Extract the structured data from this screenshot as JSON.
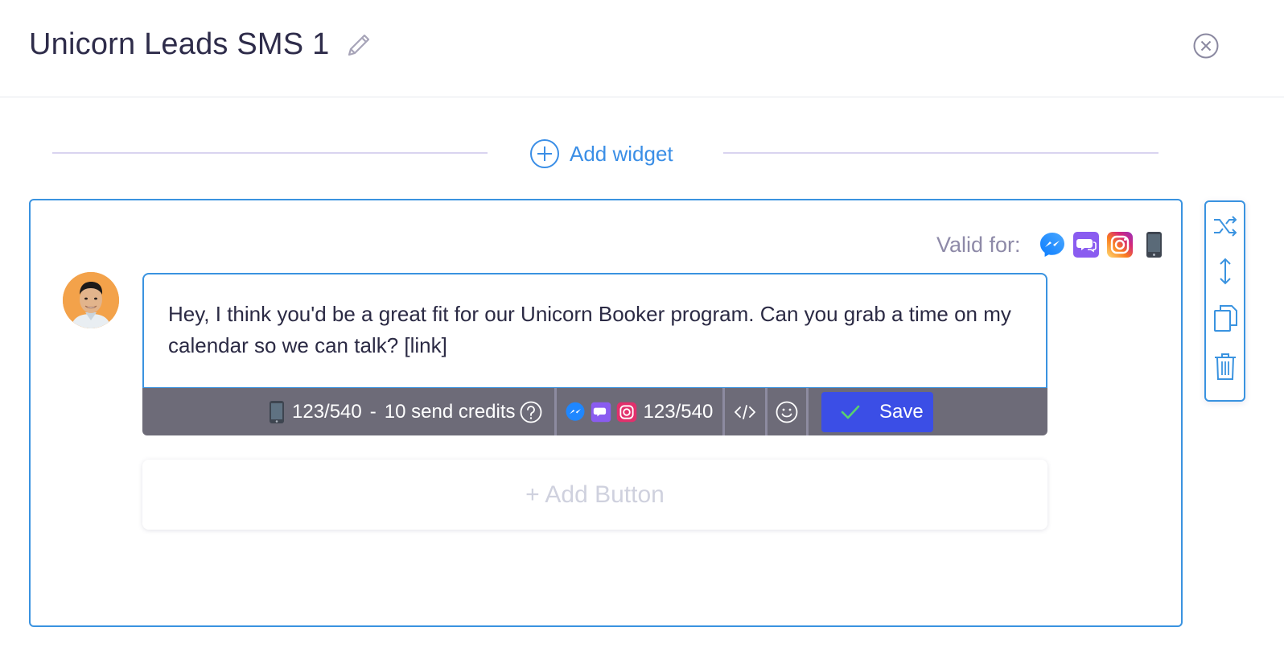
{
  "header": {
    "title": "Unicorn Leads SMS 1",
    "edit_icon": "pencil-icon",
    "close_icon": "close-circle-icon"
  },
  "add_widget": {
    "label": "Add widget",
    "icon": "plus-circle-icon"
  },
  "card": {
    "valid_for_label": "Valid for:",
    "valid_for_icons": [
      "messenger-icon",
      "chat-icon",
      "instagram-icon",
      "phone-icon"
    ],
    "message": "Hey, I think you'd be a great fit for our Unicorn Booker program. Can you grab a time on my calendar so we can talk? [link]",
    "toolbar": {
      "sms_count": "123/540",
      "separator": "-",
      "credits": "10 send credits",
      "social_count": "123/540",
      "save_label": "Save"
    },
    "add_button_label": "+ Add Button"
  },
  "side_tools": [
    "shuffle-icon",
    "resize-vertical-icon",
    "copy-icon",
    "trash-icon"
  ],
  "colors": {
    "accent_blue": "#3a93e0",
    "save_button": "#3b4ee6",
    "toolbar_bg": "#6d6b78",
    "title_text": "#2e2c4a"
  }
}
